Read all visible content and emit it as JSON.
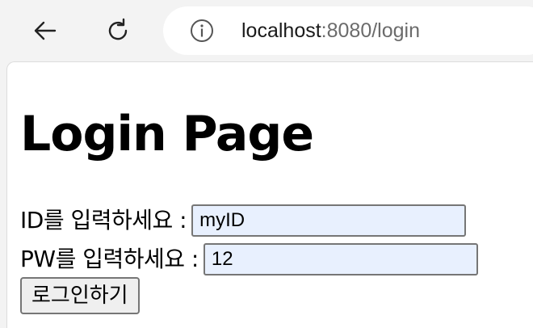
{
  "browser": {
    "url_host": "localhost",
    "url_rest": ":8080/login",
    "icons": {
      "back": "back-arrow-icon",
      "reload": "reload-icon",
      "info": "info-icon"
    }
  },
  "page": {
    "title": "Login Page",
    "id_label": "ID를 입력하세요 :",
    "id_value": "myID",
    "pw_label": "PW를 입력하세요 :",
    "pw_value": "12",
    "submit_label": "로그인하기"
  },
  "colors": {
    "toolbar_bg": "#f3f3f3",
    "autofill_bg": "#e8f0fe",
    "url_muted": "#6b6b6b"
  }
}
